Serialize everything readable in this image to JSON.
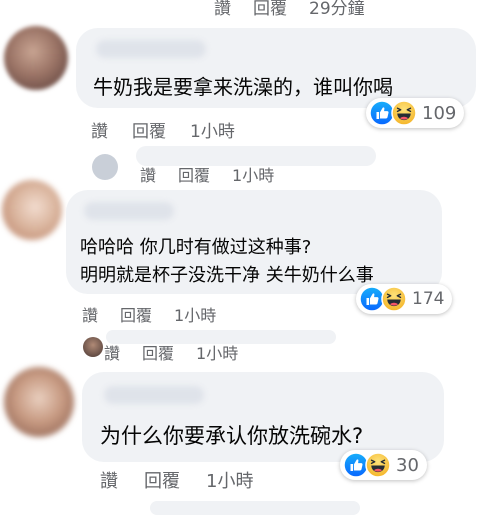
{
  "colors": {
    "bubble": "#f0f2f5",
    "secondary_text": "#65676b",
    "like_blue": "#1877f2",
    "haha_yellow": "#f7b928"
  },
  "top_partial_actions": {
    "like": "讚",
    "reply": "回覆",
    "time": "29分鐘"
  },
  "comments": [
    {
      "lines": [
        "牛奶我是要拿来洗澡的，谁叫你喝"
      ],
      "reactions": {
        "icons": [
          "like-icon",
          "haha-icon"
        ],
        "count": "109"
      },
      "actions": {
        "like": "讚",
        "reply": "回覆",
        "time": "1小時"
      }
    },
    {
      "lines": [
        "哈哈哈 你几时有做过这种事?",
        "明明就是杯子没洗干净 关牛奶什么事"
      ],
      "reactions": {
        "icons": [
          "like-icon",
          "haha-icon"
        ],
        "count": "174"
      },
      "actions": {
        "like": "讚",
        "reply": "回覆",
        "time": "1小時"
      }
    },
    {
      "lines": [
        "为什么你要承认你放洗碗水?"
      ],
      "reactions": {
        "icons": [
          "like-icon",
          "haha-icon"
        ],
        "count": "30"
      },
      "actions": {
        "like": "讚",
        "reply": "回覆",
        "time": "1小時"
      }
    }
  ],
  "reply_previews": [
    {
      "actions": {
        "like": "讚",
        "reply": "回覆",
        "time": "1小時"
      }
    },
    {
      "actions": {
        "like": "讚",
        "reply": "回覆",
        "time": "1小時"
      }
    }
  ]
}
